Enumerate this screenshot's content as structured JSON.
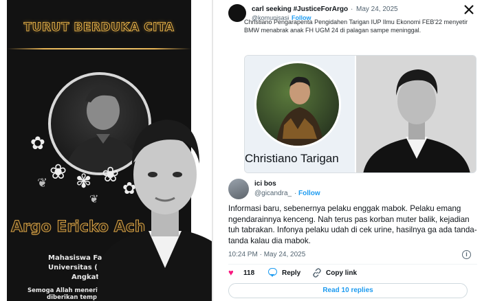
{
  "poster": {
    "title": "TURUT BERDUKA CITA",
    "name": "Argo Ericko Ach",
    "line1": "Mahasiswa Fa",
    "line2": "Universitas (",
    "line3": "Angkat",
    "line4": "Semoga Allah menerim",
    "line5": "diberikan tempat"
  },
  "quoted_post": {
    "display_name": "carl seeking #JusticeForArgo",
    "date": "May 24, 2025",
    "handle": "@komunisasi",
    "follow_label": "Follow",
    "text": "Christiano Pengarapenta Pengidahen Tarigan IUP Ilmu Ekonomi FEB'22 menyetir BMW menabrak anak FH UGM 24 di palagan sampe meninggal.",
    "image_caption": "Christiano Tarigan"
  },
  "reply_post": {
    "display_name": "ici bos",
    "handle": "@gicandra_",
    "follow_label": "Follow",
    "text": "Informasi baru, sebenernya pelaku enggak mabok. Pelaku emang ngendarainnya kenceng. Nah terus pas korban muter balik, kejadian tuh tabrakan. Infonya pelaku udah di cek urine, hasilnya ga ada tanda-tanda kalau dia mabok.",
    "timestamp": "10:24 PM · May 24, 2025",
    "like_count": "118",
    "reply_label": "Reply",
    "copy_link_label": "Copy link",
    "read_replies_label": "Read 10 replies"
  },
  "icons": [
    "x-logo-icon",
    "info-icon",
    "heart-icon",
    "reply-icon",
    "link-icon"
  ],
  "colors": {
    "accent": "#1d9bf0",
    "like": "#f91880",
    "gold": "#e8b556",
    "poster_bg": "#121212"
  }
}
